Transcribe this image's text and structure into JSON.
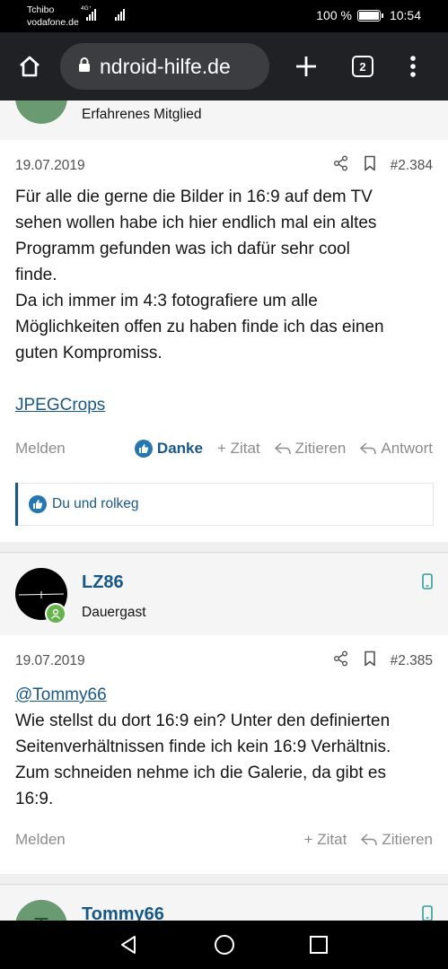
{
  "status": {
    "carrier1": "Tchibo",
    "carrier2": "vodafone.de",
    "network": "4G⁺",
    "battery_text": "100 %",
    "battery_level": 1.0,
    "time": "10:54"
  },
  "browser": {
    "url": "ndroid-hilfe.de",
    "tab_count": "2",
    "icons": [
      "home-icon",
      "lock-icon",
      "new-tab-icon",
      "tab-switcher-icon",
      "more-vert-icon"
    ]
  },
  "posts": [
    {
      "user_title": "Erfahrenes Mitglied",
      "date": "19.07.2019",
      "number": "#2.384",
      "body": [
        "Für alle die gerne die Bilder in 16:9 auf dem TV",
        "sehen wollen habe ich hier endlich mal ein altes",
        "Programm gefunden was ich dafür sehr cool",
        "finde.",
        "Da ich immer im 4:3 fotografiere um alle",
        "Möglichkeiten offen zu haben finde ich das einen",
        "guten Kompromiss."
      ],
      "link": "JPEGCrops",
      "footer": {
        "report": "Melden",
        "like": "Danke",
        "quote": "+ Zitat",
        "reply_quote": "Zitieren",
        "reply": "Antwort"
      },
      "likes_text": "Du und rolkeg"
    },
    {
      "username": "LZ86",
      "user_title": "Dauergast",
      "date": "19.07.2019",
      "number": "#2.385",
      "mention": "@Tommy66",
      "body": [
        "Wie stellst du dort 16:9 ein? Unter den definierten",
        "Seitenverhältnissen finde ich kein 16:9 Verhältnis.",
        "Zum schneiden nehme ich die Galerie, da gibt es",
        "16:9."
      ],
      "footer": {
        "report": "Melden",
        "quote": "+ Zitat",
        "reply_quote": "Zitieren"
      }
    },
    {
      "username": "Tommy66",
      "avatar_letter": "T"
    }
  ],
  "colors": {
    "accent": "#185886",
    "avatar_green": "#6a9a72",
    "online_green": "#63b449"
  }
}
